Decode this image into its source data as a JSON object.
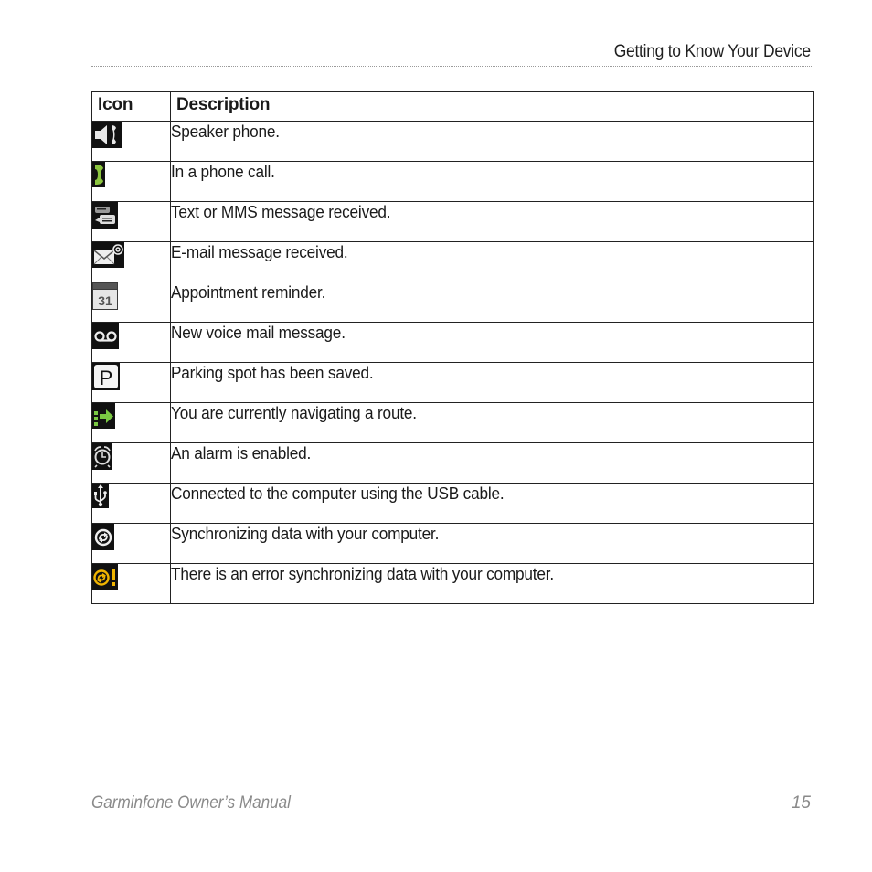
{
  "header": {
    "section_title": "Getting to Know Your Device"
  },
  "table": {
    "columns": [
      "Icon",
      "Description"
    ],
    "rows": [
      {
        "icon": "speaker-phone-icon",
        "description": "Speaker phone."
      },
      {
        "icon": "phone-call-icon",
        "description": "In a phone call."
      },
      {
        "icon": "text-message-icon",
        "description": "Text or MMS message received."
      },
      {
        "icon": "email-icon",
        "description": "E-mail message received."
      },
      {
        "icon": "calendar-icon",
        "icon_text": "31",
        "description": "Appointment reminder."
      },
      {
        "icon": "voicemail-icon",
        "description": "New voice mail message."
      },
      {
        "icon": "parking-icon",
        "icon_text": "P",
        "description": "Parking spot has been saved."
      },
      {
        "icon": "navigation-route-icon",
        "description": "You are currently navigating a route."
      },
      {
        "icon": "alarm-clock-icon",
        "description": "An alarm is enabled."
      },
      {
        "icon": "usb-icon",
        "description": "Connected to the computer using the USB cable."
      },
      {
        "icon": "sync-icon",
        "description": "Synchronizing data with your computer."
      },
      {
        "icon": "sync-error-icon",
        "description": "There is an error synchronizing data with your computer."
      }
    ]
  },
  "footer": {
    "manual_title": "Garminfone Owner’s Manual",
    "page_number": "15"
  },
  "colors": {
    "phone_green": "#8cc63f",
    "sync_error_amber": "#f0b400",
    "nav_green": "#7ac943"
  }
}
